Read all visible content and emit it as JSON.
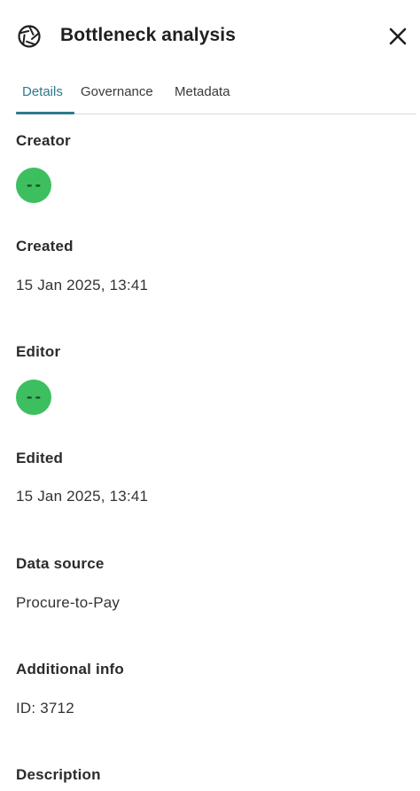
{
  "header": {
    "icon": "aperture-icon",
    "title": "Bottleneck analysis",
    "close_icon": "close-icon"
  },
  "tabs": [
    {
      "label": "Details",
      "active": true
    },
    {
      "label": "Governance",
      "active": false
    },
    {
      "label": "Metadata",
      "active": false
    }
  ],
  "details": {
    "creator": {
      "label": "Creator",
      "avatar_initials": "--"
    },
    "created": {
      "label": "Created",
      "value": "15 Jan 2025, 13:41"
    },
    "editor": {
      "label": "Editor",
      "avatar_initials": "--"
    },
    "edited": {
      "label": "Edited",
      "value": "15 Jan 2025, 13:41"
    },
    "data_source": {
      "label": "Data source",
      "value": "Procure-to-Pay"
    },
    "additional_info": {
      "label": "Additional info",
      "value": "ID: 3712"
    },
    "description": {
      "label": "Description"
    }
  },
  "colors": {
    "accent": "#2d7a8c",
    "avatar_bg": "#3dbf60",
    "divider": "#d9d9d9"
  }
}
